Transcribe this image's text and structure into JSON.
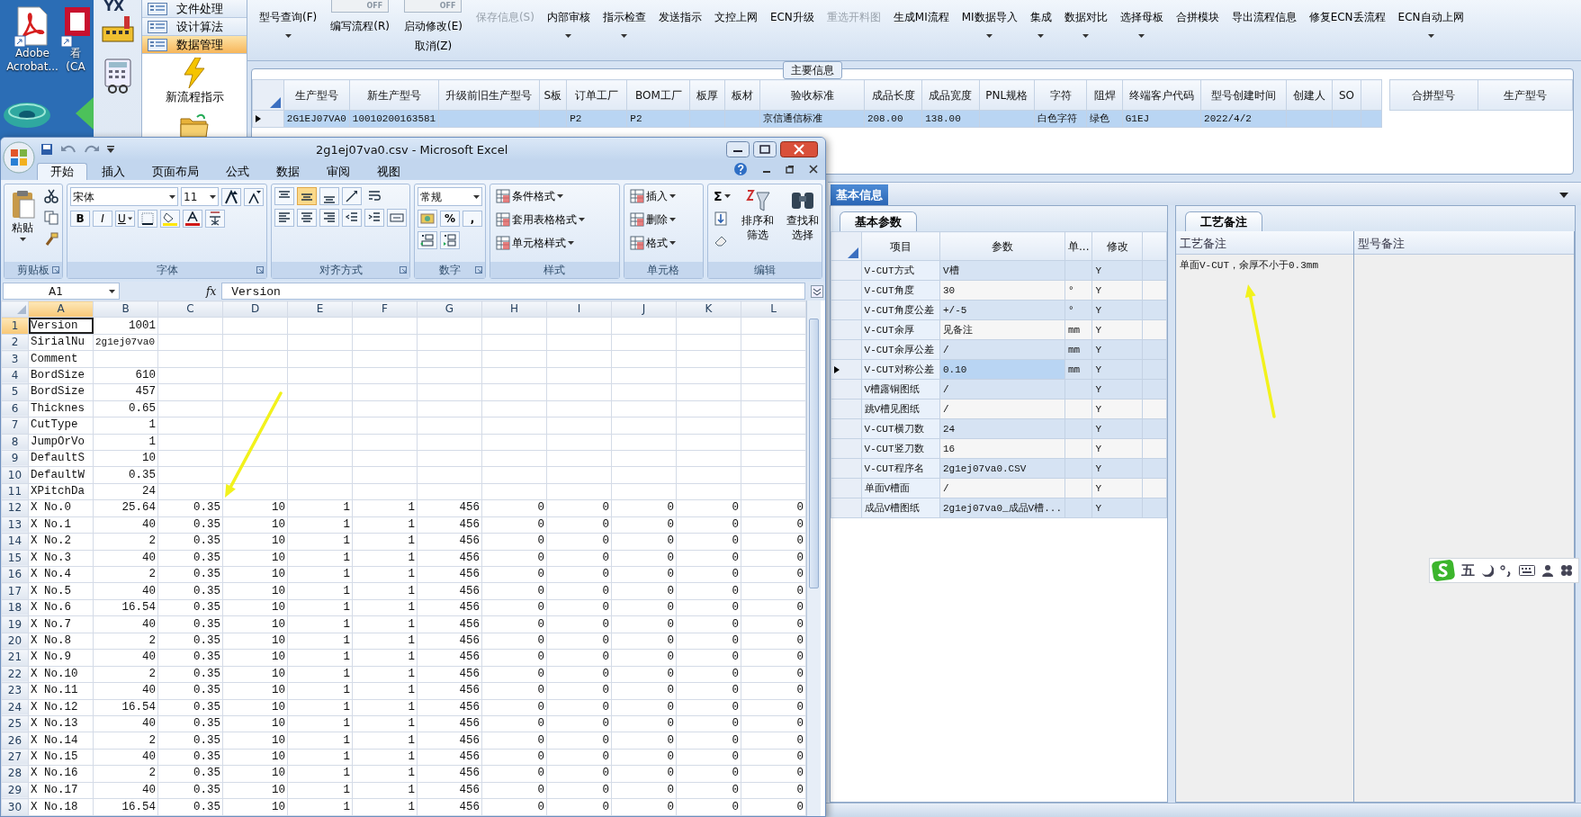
{
  "desktop": {
    "icons": [
      {
        "kind": "pdf",
        "label": "Adobe Acrobat..."
      },
      {
        "kind": "app",
        "label": "看 (CA"
      }
    ]
  },
  "app": {
    "nav_icons": [
      {
        "kind": "logo",
        "text": "YX"
      },
      {
        "kind": "calculator"
      }
    ],
    "nav_menu": [
      {
        "label": "文件处理",
        "selected": false
      },
      {
        "label": "设计算法",
        "selected": false
      },
      {
        "label": "数据管理",
        "selected": true
      }
    ],
    "nav_actions": [
      {
        "kind": "lightning",
        "label": "新流程指示"
      },
      {
        "kind": "folder"
      }
    ],
    "toolbar": [
      {
        "kind": "button",
        "label": "型号查询(F)",
        "dropdown": true,
        "disabled": false
      },
      {
        "kind": "toggle",
        "switch_text": "OFF",
        "on": false,
        "label": "编写流程(R)"
      },
      {
        "kind": "toggle",
        "switch_text": "OFF",
        "on": false,
        "label": "启动修改(E)",
        "sublabel": "取消(Z)"
      },
      {
        "kind": "button",
        "label": "保存信息(S)",
        "dropdown": false,
        "disabled": true
      },
      {
        "kind": "button",
        "label": "内部审核",
        "dropdown": true,
        "disabled": false
      },
      {
        "kind": "button",
        "label": "指示检查",
        "dropdown": true,
        "disabled": false
      },
      {
        "kind": "button",
        "label": "发送指示",
        "dropdown": false,
        "disabled": false
      },
      {
        "kind": "button",
        "label": "文控上网",
        "dropdown": false,
        "disabled": false
      },
      {
        "kind": "button",
        "label": "ECN升级",
        "dropdown": false,
        "disabled": false
      },
      {
        "kind": "button",
        "label": "重选开料图",
        "dropdown": false,
        "disabled": true
      },
      {
        "kind": "button",
        "label": "生成MI流程",
        "dropdown": false,
        "disabled": false
      },
      {
        "kind": "button",
        "label": "MI数据导入",
        "dropdown": true,
        "disabled": false
      },
      {
        "kind": "button",
        "label": "集成",
        "dropdown": true,
        "disabled": false
      },
      {
        "kind": "button",
        "label": "数据对比",
        "dropdown": true,
        "disabled": false
      },
      {
        "kind": "button",
        "label": "选择母板",
        "dropdown": true,
        "disabled": false
      },
      {
        "kind": "button",
        "label": "合拼模块",
        "dropdown": false,
        "disabled": false
      },
      {
        "kind": "button",
        "label": "导出流程信息",
        "dropdown": false,
        "disabled": false
      },
      {
        "kind": "button",
        "label": "修复ECN丢流程",
        "dropdown": false,
        "disabled": false
      },
      {
        "kind": "button",
        "label": "ECN自动上网",
        "dropdown": true,
        "disabled": false
      }
    ],
    "main_info": {
      "title": "主要信息",
      "columns": [
        "生产型号",
        "新生产型号",
        "升级前旧生产型号",
        "S板",
        "订单工厂",
        "BOM工厂",
        "板厚",
        "板材",
        "验收标准",
        "成品长度",
        "成品宽度",
        "PNL规格",
        "字符",
        "阻焊",
        "终端客户代码",
        "型号创建时间",
        "创建人",
        "SO"
      ],
      "rows": [
        {
          "selected": true,
          "cells": [
            "2G1EJ07VA0",
            "10010200163581",
            null,
            null,
            "P2",
            "P2",
            null,
            null,
            "京信通信标准",
            "208.00",
            "138.00",
            null,
            "白色字符",
            "绿色",
            "G1EJ",
            "2022/4/2",
            null,
            null
          ]
        }
      ]
    },
    "merge_grid": {
      "columns": [
        "合拼型号",
        "生产型号"
      ]
    },
    "basic_info": {
      "title": "基本信息",
      "params": {
        "tab": "基本参数",
        "columns": [
          "项目",
          "参数",
          "单...",
          "修改"
        ],
        "rows": [
          {
            "selected": false,
            "cells": [
              "V-CUT方式",
              "V槽",
              null,
              "Y"
            ]
          },
          {
            "selected": false,
            "cells": [
              "V-CUT角度",
              "30",
              "°",
              "Y"
            ]
          },
          {
            "selected": false,
            "cells": [
              "V-CUT角度公差",
              "+/-5",
              "°",
              "Y"
            ]
          },
          {
            "selected": false,
            "cells": [
              "V-CUT余厚",
              "见备注",
              "mm",
              "Y"
            ]
          },
          {
            "selected": false,
            "cells": [
              "V-CUT余厚公差",
              "/",
              "mm",
              "Y"
            ]
          },
          {
            "selected": true,
            "cells": [
              "V-CUT对称公差",
              "0.10",
              "mm",
              "Y"
            ]
          },
          {
            "selected": false,
            "cells": [
              "V槽露铜图纸",
              "/",
              null,
              "Y"
            ]
          },
          {
            "selected": false,
            "cells": [
              "跳V槽见图纸",
              "/",
              null,
              "Y"
            ]
          },
          {
            "selected": false,
            "cells": [
              "V-CUT横刀数",
              "24",
              null,
              "Y"
            ]
          },
          {
            "selected": false,
            "cells": [
              "V-CUT竖刀数",
              "16",
              null,
              "Y"
            ]
          },
          {
            "selected": false,
            "cells": [
              "V-CUT程序名",
              "2g1ej07va0.CSV",
              null,
              "Y"
            ]
          },
          {
            "selected": false,
            "cells": [
              "单面V槽面",
              "/",
              null,
              "Y"
            ]
          },
          {
            "selected": false,
            "cells": [
              "成品V槽图纸",
              "2g1ej07va0_成品V槽...",
              null,
              "Y"
            ]
          }
        ]
      },
      "notes": {
        "tab": "工艺备注",
        "columns": [
          "工艺备注",
          "型号备注"
        ],
        "values": [
          "单面V-CUT，余厚不小于0.3mm"
        ]
      }
    }
  },
  "excel": {
    "title": "2g1ej07va0.csv - Microsoft Excel",
    "tabs": [
      {
        "label": "开始",
        "selected": true
      },
      {
        "label": "插入",
        "selected": false
      },
      {
        "label": "页面布局",
        "selected": false
      },
      {
        "label": "公式",
        "selected": false
      },
      {
        "label": "数据",
        "selected": false
      },
      {
        "label": "审阅",
        "selected": false
      },
      {
        "label": "视图",
        "selected": false
      }
    ],
    "ribbon": [
      {
        "kind": "clipboard",
        "label": "剪贴板",
        "paste": "粘贴"
      },
      {
        "kind": "font",
        "label": "字体",
        "font": "宋体",
        "size": "11",
        "styles": [
          "B",
          "I",
          "U"
        ]
      },
      {
        "kind": "alignment",
        "label": "对齐方式",
        "valign": [
          {
            "selected": false
          },
          {
            "selected": true
          },
          {
            "selected": false
          }
        ]
      },
      {
        "kind": "number",
        "label": "数字",
        "format": "常规",
        "symbols": [
          "%",
          ","
        ]
      },
      {
        "kind": "styles",
        "label": "样式",
        "items": [
          "条件格式",
          "套用表格格式",
          "单元格样式"
        ]
      },
      {
        "kind": "cells",
        "label": "单元格",
        "items": [
          "插入",
          "删除",
          "格式"
        ]
      },
      {
        "kind": "editing",
        "label": "编辑",
        "sum": "Σ",
        "items": [
          "排序和筛选",
          "查找和选择"
        ]
      }
    ],
    "name_box": "A1",
    "fx": "fx",
    "formula": "Version",
    "columns": [
      {
        "label": "A",
        "selected": true
      },
      {
        "label": "B",
        "selected": false
      },
      {
        "label": "C",
        "selected": false
      },
      {
        "label": "D",
        "selected": false
      },
      {
        "label": "E",
        "selected": false
      },
      {
        "label": "F",
        "selected": false
      },
      {
        "label": "G",
        "selected": false
      },
      {
        "label": "H",
        "selected": false
      },
      {
        "label": "I",
        "selected": false
      },
      {
        "label": "J",
        "selected": false
      },
      {
        "label": "K",
        "selected": false
      },
      {
        "label": "L",
        "selected": false
      }
    ],
    "rows": [
      {
        "label": "1",
        "selected": true,
        "cells": [
          "Version",
          "1001"
        ]
      },
      {
        "label": "2",
        "selected": false,
        "cells": [
          "SirialNu",
          "2g1ej07va0"
        ]
      },
      {
        "label": "3",
        "selected": false,
        "cells": [
          "Comment"
        ]
      },
      {
        "label": "4",
        "selected": false,
        "cells": [
          "BordSize",
          "610"
        ]
      },
      {
        "label": "5",
        "selected": false,
        "cells": [
          "BordSize",
          "457"
        ]
      },
      {
        "label": "6",
        "selected": false,
        "cells": [
          "Thicknes",
          "0.65"
        ]
      },
      {
        "label": "7",
        "selected": false,
        "cells": [
          "CutType",
          "1"
        ]
      },
      {
        "label": "8",
        "selected": false,
        "cells": [
          "JumpOrVo",
          "1"
        ]
      },
      {
        "label": "9",
        "selected": false,
        "cells": [
          "DefaultS",
          "10"
        ]
      },
      {
        "label": "10",
        "selected": false,
        "cells": [
          "DefaultW",
          "0.35"
        ]
      },
      {
        "label": "11",
        "selected": false,
        "cells": [
          "XPitchDa",
          "24"
        ]
      },
      {
        "label": "12",
        "selected": false,
        "cells": [
          "X No.0",
          "25.64",
          "0.35",
          "10",
          "1",
          "1",
          "456",
          "0",
          "0",
          "0",
          "0",
          "0"
        ]
      },
      {
        "label": "13",
        "selected": false,
        "cells": [
          "X No.1",
          "40",
          "0.35",
          "10",
          "1",
          "1",
          "456",
          "0",
          "0",
          "0",
          "0",
          "0"
        ]
      },
      {
        "label": "14",
        "selected": false,
        "cells": [
          "X No.2",
          "2",
          "0.35",
          "10",
          "1",
          "1",
          "456",
          "0",
          "0",
          "0",
          "0",
          "0"
        ]
      },
      {
        "label": "15",
        "selected": false,
        "cells": [
          "X No.3",
          "40",
          "0.35",
          "10",
          "1",
          "1",
          "456",
          "0",
          "0",
          "0",
          "0",
          "0"
        ]
      },
      {
        "label": "16",
        "selected": false,
        "cells": [
          "X No.4",
          "2",
          "0.35",
          "10",
          "1",
          "1",
          "456",
          "0",
          "0",
          "0",
          "0",
          "0"
        ]
      },
      {
        "label": "17",
        "selected": false,
        "cells": [
          "X No.5",
          "40",
          "0.35",
          "10",
          "1",
          "1",
          "456",
          "0",
          "0",
          "0",
          "0",
          "0"
        ]
      },
      {
        "label": "18",
        "selected": false,
        "cells": [
          "X No.6",
          "16.54",
          "0.35",
          "10",
          "1",
          "1",
          "456",
          "0",
          "0",
          "0",
          "0",
          "0"
        ]
      },
      {
        "label": "19",
        "selected": false,
        "cells": [
          "X No.7",
          "40",
          "0.35",
          "10",
          "1",
          "1",
          "456",
          "0",
          "0",
          "0",
          "0",
          "0"
        ]
      },
      {
        "label": "20",
        "selected": false,
        "cells": [
          "X No.8",
          "2",
          "0.35",
          "10",
          "1",
          "1",
          "456",
          "0",
          "0",
          "0",
          "0",
          "0"
        ]
      },
      {
        "label": "21",
        "selected": false,
        "cells": [
          "X No.9",
          "40",
          "0.35",
          "10",
          "1",
          "1",
          "456",
          "0",
          "0",
          "0",
          "0",
          "0"
        ]
      },
      {
        "label": "22",
        "selected": false,
        "cells": [
          "X No.10",
          "2",
          "0.35",
          "10",
          "1",
          "1",
          "456",
          "0",
          "0",
          "0",
          "0",
          "0"
        ]
      },
      {
        "label": "23",
        "selected": false,
        "cells": [
          "X No.11",
          "40",
          "0.35",
          "10",
          "1",
          "1",
          "456",
          "0",
          "0",
          "0",
          "0",
          "0"
        ]
      },
      {
        "label": "24",
        "selected": false,
        "cells": [
          "X No.12",
          "16.54",
          "0.35",
          "10",
          "1",
          "1",
          "456",
          "0",
          "0",
          "0",
          "0",
          "0"
        ]
      },
      {
        "label": "25",
        "selected": false,
        "cells": [
          "X No.13",
          "40",
          "0.35",
          "10",
          "1",
          "1",
          "456",
          "0",
          "0",
          "0",
          "0",
          "0"
        ]
      },
      {
        "label": "26",
        "selected": false,
        "cells": [
          "X No.14",
          "2",
          "0.35",
          "10",
          "1",
          "1",
          "456",
          "0",
          "0",
          "0",
          "0",
          "0"
        ]
      },
      {
        "label": "27",
        "selected": false,
        "cells": [
          "X No.15",
          "40",
          "0.35",
          "10",
          "1",
          "1",
          "456",
          "0",
          "0",
          "0",
          "0",
          "0"
        ]
      },
      {
        "label": "28",
        "selected": false,
        "cells": [
          "X No.16",
          "2",
          "0.35",
          "10",
          "1",
          "1",
          "456",
          "0",
          "0",
          "0",
          "0",
          "0"
        ]
      },
      {
        "label": "29",
        "selected": false,
        "cells": [
          "X No.17",
          "40",
          "0.35",
          "10",
          "1",
          "1",
          "456",
          "0",
          "0",
          "0",
          "0",
          "0"
        ]
      },
      {
        "label": "30",
        "selected": false,
        "cells": [
          "X No.18",
          "16.54",
          "0.35",
          "10",
          "1",
          "1",
          "456",
          "0",
          "0",
          "0",
          "0",
          "0"
        ]
      }
    ]
  },
  "ime": {
    "mode": "五"
  }
}
